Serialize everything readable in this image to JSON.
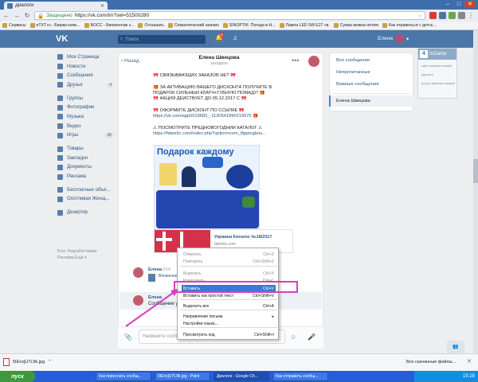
{
  "browser": {
    "tab_title": "Диалоги",
    "url_secure": "Защищено",
    "url": "https://vk.com/im?sel=51500280",
    "bookmarks": [
      "Сервисы",
      "eTXT.ru - Биржа копи...",
      "BOCC - Биомонтаж з...",
      "Отсказать",
      "Семантический анализ",
      "SINOPTIK: Погода в Н...",
      "Лампа LED 5W E27 св.",
      "Сумка можна оптом",
      "Как отравиться с детск..."
    ]
  },
  "vk": {
    "logo": "VK",
    "search_placeholder": "Поиск",
    "bell_count": "1",
    "user_name": "Елена"
  },
  "leftnav": [
    {
      "label": "Моя Страница"
    },
    {
      "label": "Новости"
    },
    {
      "label": "Сообщения"
    },
    {
      "label": "Друзья",
      "count": "4"
    },
    {
      "label": "Группы"
    },
    {
      "label": "Фотографии"
    },
    {
      "label": "Музыка"
    },
    {
      "label": "Видео"
    },
    {
      "label": "Игры",
      "count": "36"
    },
    {
      "label": "Товары"
    },
    {
      "label": "Закладки"
    },
    {
      "label": "Документы"
    },
    {
      "label": "Реклама"
    },
    {
      "label": "Бесплатные объя..."
    },
    {
      "label": "Охотливая Женщ..."
    },
    {
      "label": "Дезертир"
    }
  ],
  "footer_links": [
    "Блог  Разработчикам",
    "Реклама  Ещё ▾"
  ],
  "chat": {
    "back": "Назад",
    "name": "Елена Швецова",
    "status": "заходила",
    "lines": [
      "🎀 СВЯЗЫВАЮЩИХ ЗАКАЗОВ НЕТ 🎀",
      "",
      "🎁 ЗА АКТИВАЦИЮ ВАШЕГО ДИСКОНТА ПОЛУЧИТЕ В",
      "ПОДАРОК СИЛЬНЫЙ КЛАТЧ+ГУБНУЮ ПОМАДУ! 🎁",
      "🎀 АКЦИЯ ДЕЙСТВУЕТ ДО 05.12.2017 С 🎀",
      "",
      "🎀 ОФОРМИТЕ ДИСКОНТ ПО ССЫЛКЕ 🎀",
      "https://vk.com/app5619682_-113054189#219576 🎁",
      "",
      "⚠ ПОСМОТРИТЕ ПРЕДНОВОГОДНИЙ КАТАЛОГ ⚠",
      "https://faberlic.com/index.php?option=com_flippingboo..."
    ],
    "promo_title": "Подарок каждому",
    "card_title": "Украина Каталог №18/2017",
    "card_sub": "faberlic.com",
    "msg2_name": "Елена",
    "msg2_time": "3:14",
    "msg2_file": "Вложение",
    "msg3_name": "Елена",
    "msg3_text": "Сообщение у",
    "composer_placeholder": "Напишите сообщение..."
  },
  "filters": {
    "all": "Все сообщения",
    "unread": "Непрочитанные",
    "important": "Важные сообщения",
    "selected": "Елена Швецова"
  },
  "ext_widget": {
    "title": "InGame",
    "line1": "сайт игровых вещей",
    "line2": "удалить",
    "line3": "услугу включил вещей"
  },
  "context_menu": {
    "items": [
      {
        "label": "Отменить",
        "shortcut": "Ctrl+Z"
      },
      {
        "label": "Повторить",
        "shortcut": "Ctrl+Shift+Z"
      },
      {
        "label": "Вырезать",
        "shortcut": "Ctrl+X"
      },
      {
        "label": "Копировать",
        "shortcut": "Ctrl+C"
      },
      {
        "label": "Вставить",
        "shortcut": "Ctrl+V"
      },
      {
        "label": "Вставить как простой текст",
        "shortcut": "Ctrl+Shift+V"
      },
      {
        "label": "Выделить все",
        "shortcut": "Ctrl+A"
      },
      {
        "label": "Направление письма",
        "shortcut": "▸"
      },
      {
        "label": "Настройки языка...",
        "shortcut": ""
      },
      {
        "label": "Просмотреть код",
        "shortcut": "Ctrl+Shift+I"
      }
    ]
  },
  "downloads": {
    "file": "5IEnzjU7L9k.jpg",
    "all_link": "Все скачанные файлы..."
  },
  "taskbar": {
    "start": "пуск",
    "items": [
      "Как переслать сообщ...",
      "5IEnzjU7L9k.jpg - Paint",
      "Диалоги - Google Ch...",
      "Как отправить сообщ..."
    ],
    "time": "15:28"
  }
}
